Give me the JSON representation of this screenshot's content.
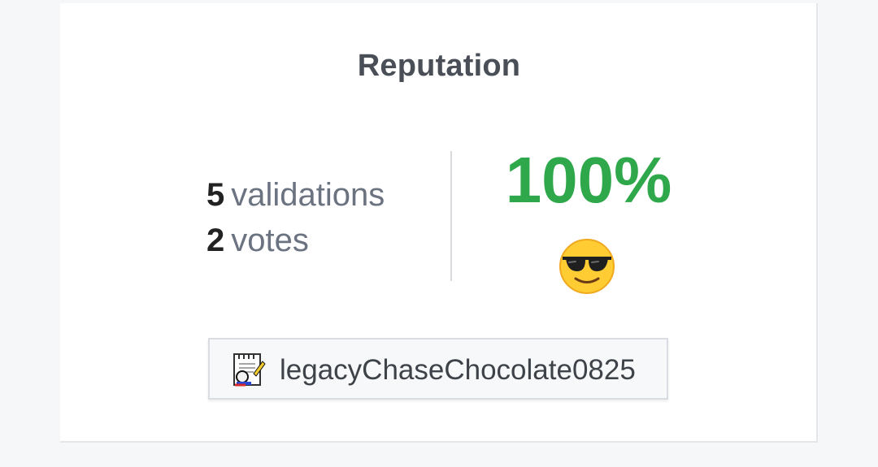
{
  "card": {
    "title": "Reputation",
    "validations": {
      "count": "5",
      "label": "validations"
    },
    "votes": {
      "count": "2",
      "label": "votes"
    },
    "score": "100%",
    "score_color": "#2ea84a",
    "mood_icon": "sunglasses-face-icon",
    "user": {
      "icon": "notepad-user-icon",
      "name": "legacyChaseChocolate0825"
    }
  }
}
